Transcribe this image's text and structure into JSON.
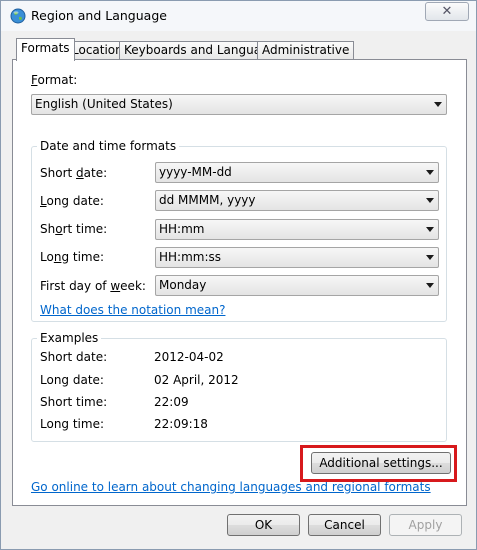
{
  "window": {
    "title": "Region and Language",
    "close_glyph": "✕"
  },
  "tabs": [
    {
      "label": "Formats",
      "active": true
    },
    {
      "label": "Location",
      "active": false
    },
    {
      "label": "Keyboards and Languages",
      "active": false
    },
    {
      "label": "Administrative",
      "active": false
    }
  ],
  "format": {
    "label_prefix": "",
    "label_key": "F",
    "label_rest": "ormat:",
    "value": "English (United States)"
  },
  "date_time_formats": {
    "title": "Date and time formats",
    "short_date": {
      "label_a": "Short ",
      "label_key": "d",
      "label_b": "ate:",
      "value": "yyyy-MM-dd"
    },
    "long_date": {
      "label_a": "",
      "label_key": "L",
      "label_b": "ong date:",
      "value": "dd MMMM, yyyy"
    },
    "short_time": {
      "label_a": "Sh",
      "label_key": "o",
      "label_b": "rt time:",
      "value": "HH:mm"
    },
    "long_time": {
      "label_a": "Lo",
      "label_key": "n",
      "label_b": "g time:",
      "value": "HH:mm:ss"
    },
    "first_day": {
      "label_a": "First day of ",
      "label_key": "w",
      "label_b": "eek:",
      "value": "Monday"
    },
    "notation_link": "What does the notation mean?"
  },
  "examples": {
    "title": "Examples",
    "rows": [
      {
        "label": "Short date:",
        "value": "2012-04-02"
      },
      {
        "label": "Long date:",
        "value": "02 April, 2012"
      },
      {
        "label": "Short time:",
        "value": "22:09"
      },
      {
        "label": "Long time:",
        "value": "22:09:18"
      }
    ]
  },
  "additional_settings_label": "Additional settings...",
  "online_link": "Go online to learn about changing languages and regional formats",
  "buttons": {
    "ok": "OK",
    "cancel": "Cancel",
    "apply": "Apply"
  },
  "colors": {
    "highlight": "#d7191c",
    "link": "#0066cc"
  }
}
